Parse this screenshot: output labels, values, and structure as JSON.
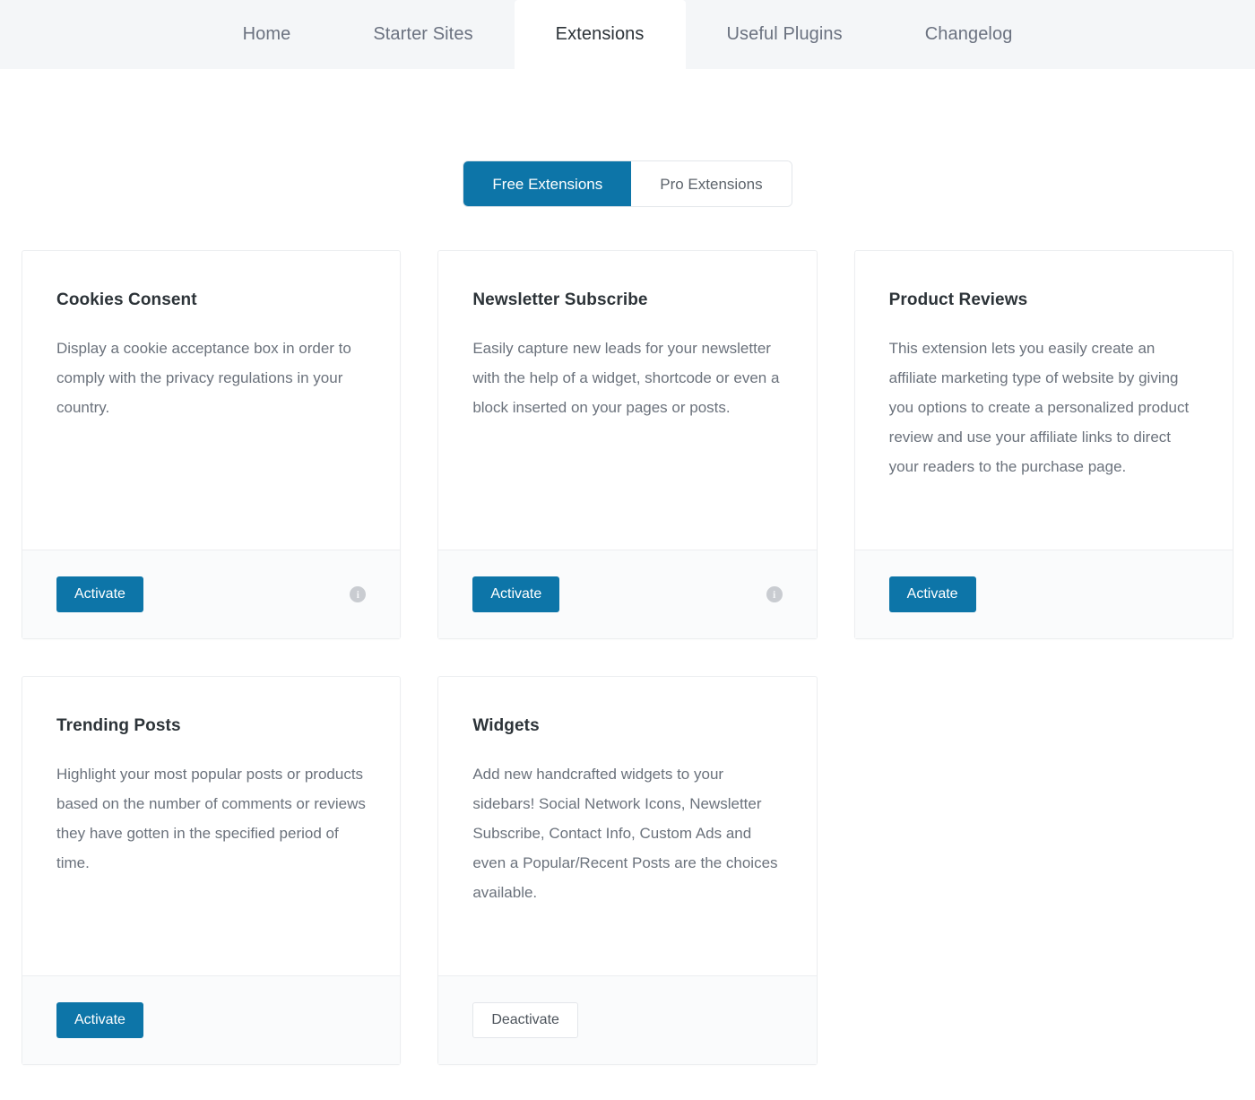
{
  "navbar": {
    "items": [
      {
        "label": "Home",
        "active": false
      },
      {
        "label": "Starter Sites",
        "active": false
      },
      {
        "label": "Extensions",
        "active": true
      },
      {
        "label": "Useful Plugins",
        "active": false
      },
      {
        "label": "Changelog",
        "active": false
      }
    ]
  },
  "toggle": {
    "free_label": "Free Extensions",
    "pro_label": "Pro Extensions",
    "selected": "Free Extensions"
  },
  "colors": {
    "accent": "#0d75a8",
    "header_bg": "#f4f6f8",
    "card_footer_bg": "#fafbfc",
    "card_border": "#eceef0",
    "title": "#2c3338",
    "body_text": "#6b727c"
  },
  "cards": [
    {
      "title": "Cookies Consent",
      "description": "Display a cookie acceptance box in order to comply with the privacy regulations in your country.",
      "action_label": "Activate",
      "action_style": "primary",
      "has_info_icon": true,
      "info_icon_glyph": "i"
    },
    {
      "title": "Newsletter Subscribe",
      "description": "Easily capture new leads for your newsletter with the help of a widget, shortcode or even a block inserted on your pages or posts.",
      "action_label": "Activate",
      "action_style": "primary",
      "has_info_icon": true,
      "info_icon_glyph": "i"
    },
    {
      "title": "Product Reviews",
      "description": "This extension lets you easily create an affiliate marketing type of website by giving you options to create a personalized product review and use your affiliate links to direct your readers to the purchase page.",
      "action_label": "Activate",
      "action_style": "primary",
      "has_info_icon": false,
      "info_icon_glyph": ""
    },
    {
      "title": "Trending Posts",
      "description": "Highlight your most popular posts or products based on the number of comments or reviews they have gotten in the specified period of time.",
      "action_label": "Activate",
      "action_style": "primary",
      "has_info_icon": false,
      "info_icon_glyph": ""
    },
    {
      "title": "Widgets",
      "description": "Add new handcrafted widgets to your sidebars! Social Network Icons, Newsletter Subscribe, Contact Info, Custom Ads and even a Popular/Recent Posts are the choices available.",
      "action_label": "Deactivate",
      "action_style": "secondary",
      "has_info_icon": false,
      "info_icon_glyph": ""
    }
  ]
}
